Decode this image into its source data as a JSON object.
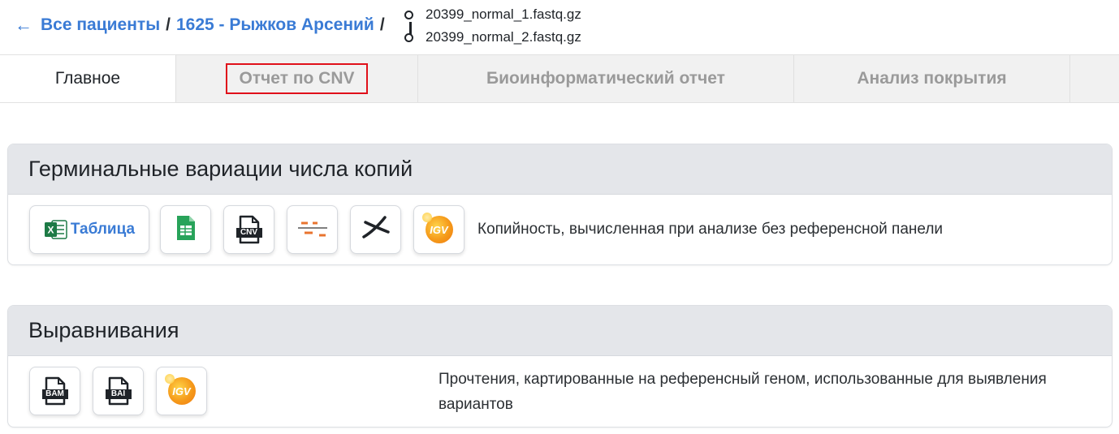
{
  "breadcrumb": {
    "back_arrow": "←",
    "all_patients": "Все пациенты",
    "separator1": "/",
    "patient": "1625 - Рыжков Арсений",
    "separator2": "/"
  },
  "files": [
    "20399_normal_1.fastq.gz",
    "20399_normal_2.fastq.gz"
  ],
  "tabs": [
    {
      "label": "Главное",
      "active": true
    },
    {
      "label": "Отчет по CNV",
      "highlighted": true
    },
    {
      "label": "Биоинформатический отчет"
    },
    {
      "label": "Анализ покрытия"
    }
  ],
  "sections": {
    "cnv": {
      "title": "Герминальные вариации числа копий",
      "table_button": "Таблица",
      "cnv_label": "CNV",
      "igv_label": "IGV",
      "description": "Копийность, вычисленная при анализе без референсной панели",
      "buttons": [
        "excel-table",
        "google-sheets",
        "cnv-file",
        "segments",
        "chromosome",
        "igv"
      ]
    },
    "alignments": {
      "title": "Выравнивания",
      "bam_label": "BAM",
      "bai_label": "BAI",
      "igv_label": "IGV",
      "description": "Прочтения, картированные на референсный геном, использованные для выявления вариантов",
      "buttons": [
        "bam-file",
        "bai-file",
        "igv"
      ]
    }
  },
  "colors": {
    "link": "#3a7bd5",
    "highlight": "#e0101a",
    "header_bg": "#e4e6ea",
    "excel_green": "#1d7a45",
    "sheets_green": "#28a35a",
    "segment_orange": "#e8742f"
  }
}
